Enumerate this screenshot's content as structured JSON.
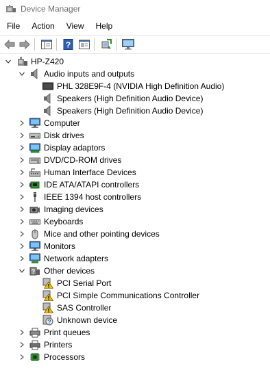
{
  "window": {
    "title": "Device Manager"
  },
  "menu": [
    "File",
    "Action",
    "View",
    "Help"
  ],
  "toolbar": [
    "back-icon",
    "forward-icon",
    "properties-pane-icon",
    "help-icon",
    "show-hidden-icon",
    "scan-hardware-icon",
    "monitor-icon"
  ],
  "tree": [
    {
      "level": 0,
      "label": "HP-Z420",
      "icon": "computer-root-icon",
      "expanded": true
    },
    {
      "level": 1,
      "label": "Audio inputs and outputs",
      "icon": "speaker-icon",
      "expanded": true
    },
    {
      "level": 2,
      "label": "PHL 328E9F-4 (NVIDIA High Definition Audio)",
      "icon": "monitor-audio-icon"
    },
    {
      "level": 2,
      "label": "Speakers (High Definition Audio Device)",
      "icon": "speaker-icon"
    },
    {
      "level": 2,
      "label": "Speakers (High Definition Audio Device)",
      "icon": "speaker-icon"
    },
    {
      "level": 1,
      "label": "Computer",
      "icon": "computer-icon",
      "expanded": false
    },
    {
      "level": 1,
      "label": "Disk drives",
      "icon": "disk-drive-icon",
      "expanded": false
    },
    {
      "level": 1,
      "label": "Display adaptors",
      "icon": "display-adapter-icon",
      "expanded": false
    },
    {
      "level": 1,
      "label": "DVD/CD-ROM drives",
      "icon": "dvd-drive-icon",
      "expanded": false
    },
    {
      "level": 1,
      "label": "Human Interface Devices",
      "icon": "hid-icon",
      "expanded": false
    },
    {
      "level": 1,
      "label": "IDE ATA/ATAPI controllers",
      "icon": "ide-controller-icon",
      "expanded": false
    },
    {
      "level": 1,
      "label": "IEEE 1394 host controllers",
      "icon": "firewire-icon",
      "expanded": false
    },
    {
      "level": 1,
      "label": "Imaging devices",
      "icon": "camera-icon",
      "expanded": false
    },
    {
      "level": 1,
      "label": "Keyboards",
      "icon": "keyboard-icon",
      "expanded": false
    },
    {
      "level": 1,
      "label": "Mice and other pointing devices",
      "icon": "mouse-icon",
      "expanded": false
    },
    {
      "level": 1,
      "label": "Monitors",
      "icon": "monitor-icon",
      "expanded": false
    },
    {
      "level": 1,
      "label": "Network adapters",
      "icon": "network-adapter-icon",
      "expanded": false
    },
    {
      "level": 1,
      "label": "Other devices",
      "icon": "other-devices-icon",
      "expanded": true
    },
    {
      "level": 2,
      "label": "PCI Serial Port",
      "icon": "warning-device-icon"
    },
    {
      "level": 2,
      "label": "PCI Simple Communications Controller",
      "icon": "warning-device-icon"
    },
    {
      "level": 2,
      "label": "SAS Controller",
      "icon": "warning-device-icon"
    },
    {
      "level": 2,
      "label": "Unknown device",
      "icon": "unknown-device-icon"
    },
    {
      "level": 1,
      "label": "Print queues",
      "icon": "print-queue-icon",
      "expanded": false
    },
    {
      "level": 1,
      "label": "Printers",
      "icon": "printer-icon",
      "expanded": false
    },
    {
      "level": 1,
      "label": "Processors",
      "icon": "processor-icon",
      "expanded": false
    }
  ]
}
